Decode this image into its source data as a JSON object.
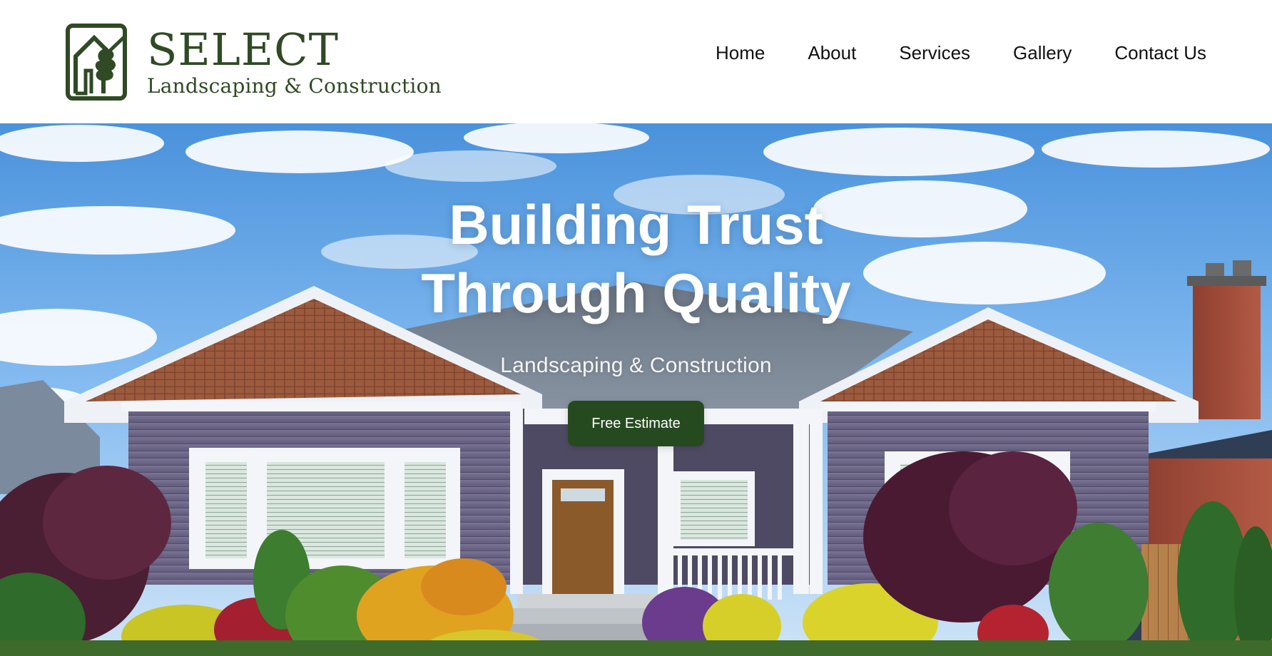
{
  "brand": {
    "title": "SELECT",
    "subtitle": "Landscaping & Construction",
    "color": "#2f4a24",
    "logo_icon": "house-tree-logo-icon"
  },
  "nav": {
    "items": [
      {
        "label": "Home"
      },
      {
        "label": "About"
      },
      {
        "label": "Services"
      },
      {
        "label": "Gallery"
      },
      {
        "label": "Contact Us"
      }
    ]
  },
  "hero": {
    "title_line1": "Building Trust",
    "title_line2": "Through Quality",
    "subtitle": "Landscaping & Construction",
    "cta_label": "Free Estimate",
    "cta_color": "#264a1f"
  }
}
